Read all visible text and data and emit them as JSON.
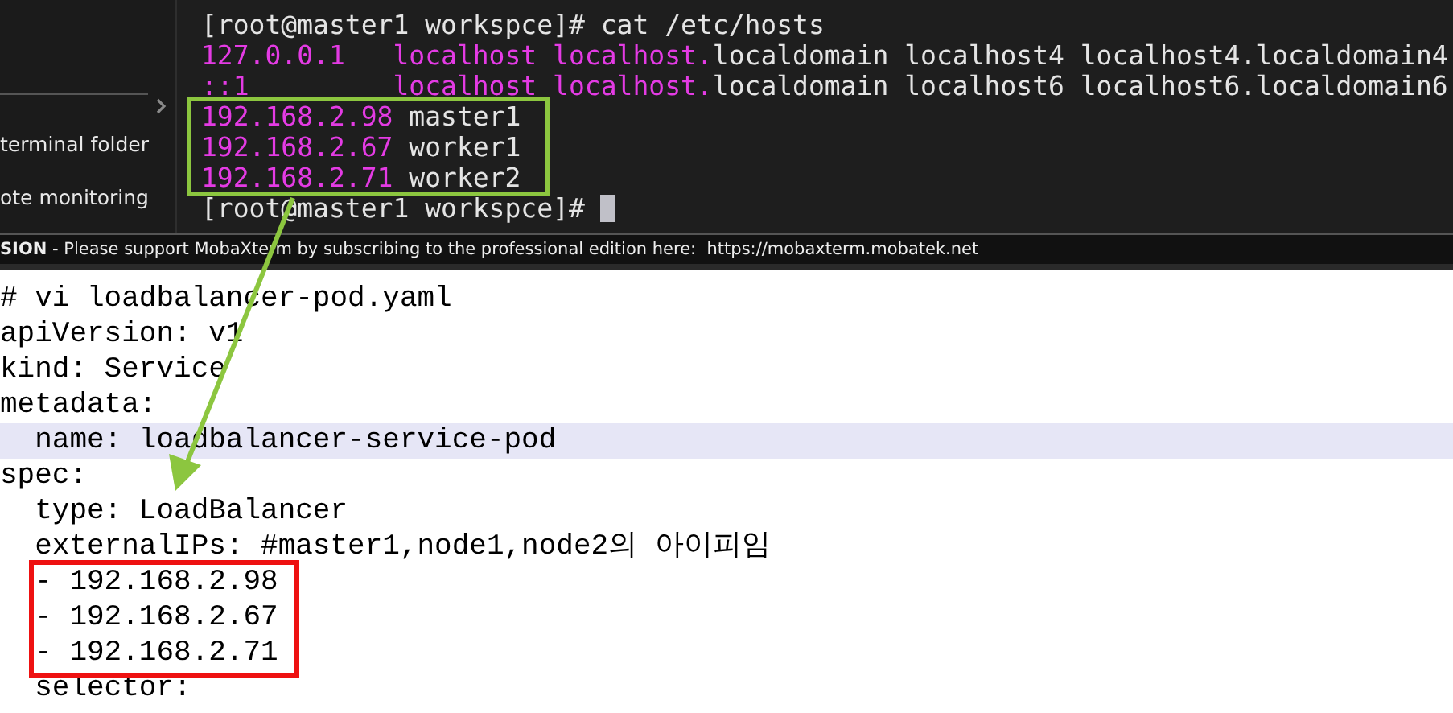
{
  "sidebar": {
    "items": [
      {
        "label": "terminal folder"
      },
      {
        "label": "ote monitoring"
      }
    ]
  },
  "terminal": {
    "lines": [
      {
        "cursor": false,
        "segments": [
          {
            "text": "[root@master1 workspce]# cat /etc/hosts",
            "kind": "plain"
          }
        ]
      },
      {
        "cursor": false,
        "segments": [
          {
            "text": "127.0.0.1   localhost localhost.",
            "kind": "address"
          },
          {
            "text": "localdomain localhost4 localhost4.localdomain4",
            "kind": "plain"
          }
        ]
      },
      {
        "cursor": false,
        "segments": [
          {
            "text": "::1         localhost localhost.",
            "kind": "address"
          },
          {
            "text": "localdomain localhost6 localhost6.localdomain6",
            "kind": "plain"
          }
        ]
      },
      {
        "cursor": false,
        "segments": [
          {
            "text": "192.168.2.98",
            "kind": "address"
          },
          {
            "text": " master1",
            "kind": "plain"
          }
        ]
      },
      {
        "cursor": false,
        "segments": [
          {
            "text": "192.168.2.67",
            "kind": "address"
          },
          {
            "text": " worker1",
            "kind": "plain"
          }
        ]
      },
      {
        "cursor": false,
        "segments": [
          {
            "text": "192.168.2.71",
            "kind": "address"
          },
          {
            "text": " worker2",
            "kind": "plain"
          }
        ]
      },
      {
        "cursor": true,
        "segments": [
          {
            "text": "[root@master1 workspce]# ",
            "kind": "plain"
          }
        ]
      }
    ]
  },
  "status_bar": {
    "edition": "SION",
    "message": " - Please support MobaXterm by subscribing to the professional edition here:  ",
    "link": "https://mobaxterm.mobatek.net"
  },
  "editor": {
    "lines": [
      {
        "text": "# vi loadbalancer-pod.yaml",
        "current": false
      },
      {
        "text": "apiVersion: v1",
        "current": false
      },
      {
        "text": "kind: Service",
        "current": false
      },
      {
        "text": "metadata:",
        "current": false
      },
      {
        "text": "  name: loadbalancer-service-pod",
        "current": true
      },
      {
        "text": "spec:",
        "current": false
      },
      {
        "text": "  type: LoadBalancer",
        "current": false
      },
      {
        "text": "  externalIPs: #master1,node1,node2의 아이피임",
        "current": false
      },
      {
        "text": "  - 192.168.2.98",
        "current": false
      },
      {
        "text": "  - 192.168.2.67",
        "current": false
      },
      {
        "text": "  - 192.168.2.71",
        "current": false
      },
      {
        "text": "  selector:",
        "current": false
      }
    ]
  }
}
